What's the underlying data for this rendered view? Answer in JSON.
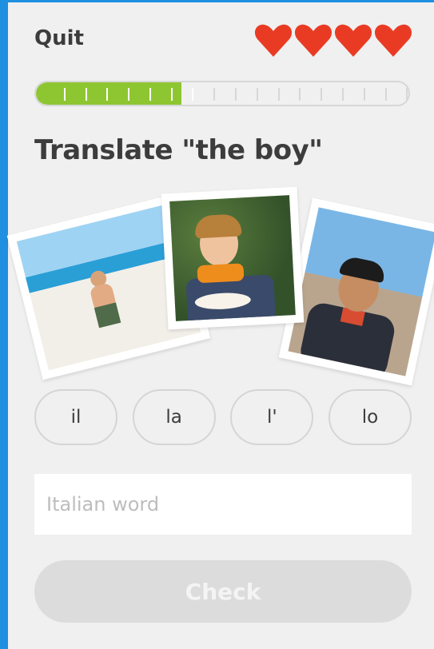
{
  "header": {
    "quit_label": "Quit",
    "hearts": [
      "heart-icon",
      "heart-icon",
      "heart-icon",
      "heart-icon"
    ],
    "heart_color": "#e93b24"
  },
  "progress": {
    "fraction": 0.39,
    "segments_total": 18,
    "segments_completed": 7,
    "fill_color": "#8ec631"
  },
  "question": {
    "prompt": "Translate \"the boy\""
  },
  "choices": [
    {
      "label": "il"
    },
    {
      "label": "la"
    },
    {
      "label": "l'"
    },
    {
      "label": "lo"
    }
  ],
  "answer_input": {
    "value": "",
    "placeholder": "Italian word"
  },
  "check_button": {
    "label": "Check",
    "disabled": true
  }
}
